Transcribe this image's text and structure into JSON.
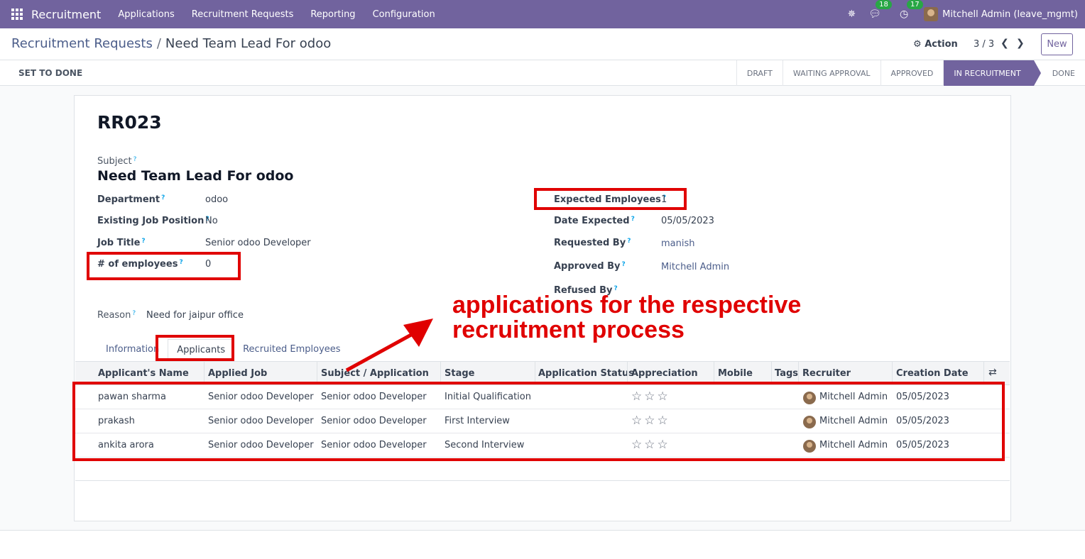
{
  "navbar": {
    "app_name": "Recruitment",
    "menu": [
      "Applications",
      "Recruitment Requests",
      "Reporting",
      "Configuration"
    ],
    "messages_count": "18",
    "activities_count": "17",
    "user": "Mitchell Admin (leave_mgmt)"
  },
  "control": {
    "breadcrumb_parent": "Recruitment Requests",
    "breadcrumb_current": "Need Team Lead For odoo",
    "action_label": "Action",
    "pager": "3 / 3",
    "new_label": "New"
  },
  "statusbar": {
    "set_done_label": "SET TO DONE",
    "stages": [
      "DRAFT",
      "WAITING APPROVAL",
      "APPROVED",
      "IN RECRUITMENT",
      "DONE"
    ],
    "active_stage": "IN RECRUITMENT"
  },
  "record": {
    "reference": "RR023",
    "subject_label": "Subject",
    "subject": "Need Team Lead For odoo",
    "department_label": "Department",
    "department": "odoo",
    "existing_job_label": "Existing Job Position",
    "existing_job": "No",
    "job_title_label": "Job Title",
    "job_title": "Senior odoo Developer",
    "num_employees_label": "# of employees",
    "num_employees": "0",
    "expected_employees_label": "Expected Employees",
    "expected_employees": "1",
    "date_expected_label": "Date Expected",
    "date_expected": "05/05/2023",
    "requested_by_label": "Requested By",
    "requested_by": "manish",
    "approved_by_label": "Approved By",
    "approved_by": "Mitchell Admin",
    "refused_by_label": "Refused By",
    "reason_label": "Reason",
    "reason": "Need for jaipur office"
  },
  "tabs": [
    "Information",
    "Applicants",
    "Recruited Employees"
  ],
  "table": {
    "columns": [
      "Applicant's Name",
      "Applied Job",
      "Subject / Application",
      "Stage",
      "Application Status",
      "Appreciation",
      "Mobile",
      "Tags",
      "Recruiter",
      "Creation Date"
    ],
    "rows": [
      {
        "name": "pawan sharma",
        "job": "Senior odoo Developer",
        "subject": "Senior odoo Developer",
        "stage": "Initial Qualification",
        "status": "",
        "stars": "☆☆☆",
        "mobile": "",
        "tags": "",
        "recruiter": "Mitchell Admin",
        "date": "05/05/2023"
      },
      {
        "name": "prakash",
        "job": "Senior odoo Developer",
        "subject": "Senior odoo Developer",
        "stage": "First Interview",
        "status": "",
        "stars": "☆☆☆",
        "mobile": "",
        "tags": "",
        "recruiter": "Mitchell Admin",
        "date": "05/05/2023"
      },
      {
        "name": "ankita arora",
        "job": "Senior odoo Developer",
        "subject": "Senior odoo Developer",
        "stage": "Second Interview",
        "status": "",
        "stars": "☆☆☆",
        "mobile": "",
        "tags": "",
        "recruiter": "Mitchell Admin",
        "date": "05/05/2023"
      }
    ]
  },
  "annotation": {
    "line1": "applications for the respective",
    "line2": "recruitment process",
    "color": "#e00000"
  },
  "colors": {
    "brand": "#71639e",
    "link": "#4b5d8a"
  }
}
